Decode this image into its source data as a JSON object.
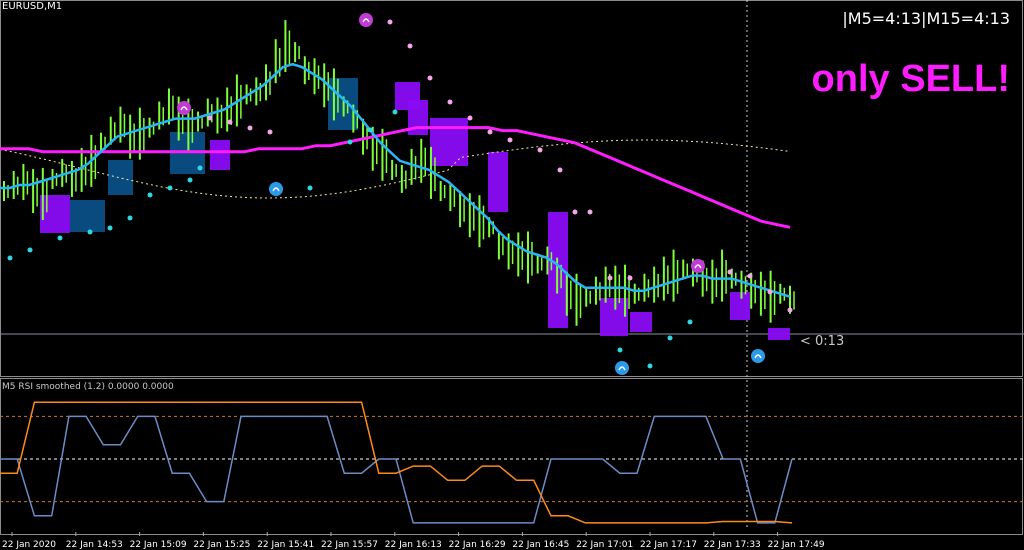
{
  "header": {
    "symbol_label": "EURUSD,M1",
    "timer_text": "|M5=4:13|M15=4:13",
    "signal_text": "only SELL!",
    "price_timer": "< 0:13"
  },
  "indicator": {
    "label": "M5 RSI smoothed (1.2) 0.0000 0.0000"
  },
  "colors": {
    "background": "#000000",
    "candle": "#7fff3a",
    "box_up": "#0a4f86",
    "box_down": "#8a0bf5",
    "fast_ma": "#29b6f6",
    "slow_ma": "#ff1dff",
    "envelope": "#f5e6a0",
    "dot_up": "#31d7e0",
    "dot_down": "#f3a7e8",
    "rsi_blue": "#6b8cc7",
    "rsi_orange": "#ff8a1a",
    "level_orange": "#c87a2a",
    "level_white": "#ffffff"
  },
  "chart_data": {
    "type": "line",
    "x_ticks": [
      "22 Jan 2020",
      "22 Jan 14:53",
      "22 Jan 15:09",
      "22 Jan 15:25",
      "22 Jan 15:41",
      "22 Jan 15:57",
      "22 Jan 16:13",
      "22 Jan 16:29",
      "22 Jan 16:45",
      "22 Jan 17:01",
      "22 Jan 17:17",
      "22 Jan 17:33",
      "22 Jan 17:49"
    ],
    "price_series": {
      "y_range": [
        0,
        100
      ],
      "close": [
        48,
        50,
        51,
        48,
        47,
        52,
        54,
        52,
        55,
        58,
        64,
        68,
        70,
        66,
        67,
        69,
        73,
        76,
        72,
        70,
        71,
        74,
        73,
        75,
        78,
        80,
        81,
        84,
        91,
        96,
        94,
        88,
        86,
        83,
        80,
        76,
        72,
        66,
        62,
        60,
        55,
        52,
        56,
        58,
        54,
        48,
        46,
        42,
        40,
        38,
        36,
        30,
        28,
        27,
        26,
        24,
        25,
        20,
        14,
        12,
        13,
        15,
        17,
        16,
        15,
        14,
        16,
        17,
        19,
        20,
        22,
        21,
        19,
        18,
        20,
        19,
        17,
        15,
        14,
        13,
        14,
        12
      ],
      "fast_ma": [
        49,
        49,
        50,
        50,
        51,
        52,
        53,
        54,
        55,
        57,
        60,
        63,
        66,
        67,
        68,
        69,
        70,
        71,
        72,
        72,
        72,
        73,
        74,
        75,
        77,
        79,
        81,
        83,
        86,
        89,
        90,
        89,
        87,
        85,
        82,
        79,
        76,
        72,
        68,
        64,
        61,
        58,
        57,
        56,
        55,
        53,
        51,
        48,
        45,
        42,
        39,
        35,
        32,
        30,
        28,
        27,
        26,
        24,
        21,
        18,
        16,
        16,
        16,
        16,
        16,
        15,
        15,
        16,
        17,
        18,
        19,
        20,
        20,
        19,
        19,
        19,
        18,
        17,
        16,
        15,
        14,
        13
      ],
      "slow_ma": [
        62,
        62,
        62,
        61,
        61,
        61,
        61,
        61,
        61,
        61,
        61,
        61,
        61,
        61,
        61,
        61,
        61,
        61,
        62,
        62,
        62,
        62,
        63,
        63,
        64,
        65,
        66,
        67,
        68,
        69,
        69,
        69,
        69,
        69,
        69,
        68,
        68,
        67,
        66,
        65,
        64,
        62,
        60,
        58,
        56,
        54,
        52,
        50,
        48,
        46,
        44,
        42,
        40,
        38,
        37,
        36
      ]
    },
    "indicator_series": {
      "y_range": [
        0,
        100
      ],
      "levels": [
        20,
        50,
        80
      ],
      "rsi_blue": [
        50,
        50,
        10,
        10,
        80,
        80,
        60,
        60,
        80,
        80,
        40,
        40,
        20,
        20,
        80,
        80,
        80,
        80,
        80,
        80,
        40,
        40,
        50,
        50,
        5,
        5,
        5,
        5,
        5,
        5,
        5,
        5,
        50,
        50,
        50,
        50,
        40,
        40,
        80,
        80,
        80,
        80,
        50,
        50,
        5,
        5,
        50
      ],
      "rsi_orange": [
        40,
        40,
        90,
        90,
        90,
        90,
        90,
        90,
        90,
        90,
        90,
        90,
        90,
        90,
        90,
        90,
        90,
        90,
        90,
        90,
        90,
        90,
        40,
        40,
        45,
        45,
        35,
        35,
        45,
        45,
        35,
        35,
        10,
        10,
        5,
        5,
        5,
        5,
        5,
        5,
        5,
        5,
        6,
        6,
        6,
        6,
        5
      ]
    }
  }
}
